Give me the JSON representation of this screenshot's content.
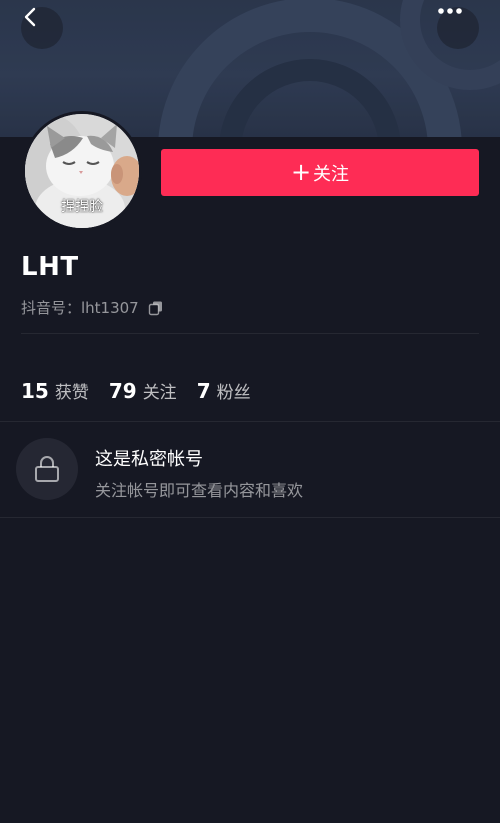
{
  "header": {
    "back_icon": "chevron-left-icon",
    "more_icon": "more-dots-icon"
  },
  "profile": {
    "avatar_caption": "捏捏脸",
    "follow_button_label": "关注",
    "follow_button_icon": "+",
    "name": "LHT",
    "account_id_label": "抖音号：lht1307",
    "copy_icon": "copy-icon"
  },
  "stats": [
    {
      "value": "15",
      "label": "获赞"
    },
    {
      "value": "79",
      "label": "关注"
    },
    {
      "value": "7",
      "label": "粉丝"
    }
  ],
  "private_notice": {
    "icon": "lock-icon",
    "title": "这是私密帐号",
    "description": "关注帐号即可查看内容和喜欢"
  },
  "colors": {
    "background": "#161823",
    "accent": "#fe2c55",
    "banner": "#2f3b52"
  }
}
